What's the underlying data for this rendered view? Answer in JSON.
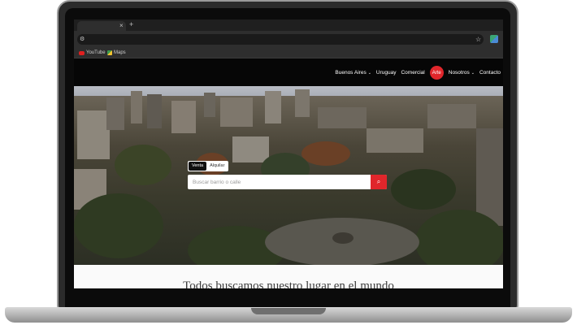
{
  "browser": {
    "tab_close": "×",
    "new_tab": "+",
    "bookmarks": [
      {
        "label": "YouTube",
        "icon": "youtube-icon"
      },
      {
        "label": "Maps",
        "icon": "maps-icon"
      }
    ]
  },
  "site": {
    "nav": [
      {
        "label": "Buenos Aires",
        "dropdown": true
      },
      {
        "label": "Uruguay",
        "dropdown": false
      },
      {
        "label": "Comercial",
        "dropdown": false
      },
      {
        "label": "Arte",
        "dropdown": false,
        "highlight": true
      },
      {
        "label": "Nosotros",
        "dropdown": true
      },
      {
        "label": "Contacto",
        "dropdown": false
      }
    ],
    "accent_color": "#e0262b"
  },
  "search": {
    "tabs": [
      {
        "label": "Venta",
        "active": true
      },
      {
        "label": "Alquilar",
        "active": false
      }
    ],
    "placeholder": "Buscar barrio o calle",
    "button_icon": "search-icon"
  },
  "headline": "Todos buscamos nuestro lugar en el mundo"
}
